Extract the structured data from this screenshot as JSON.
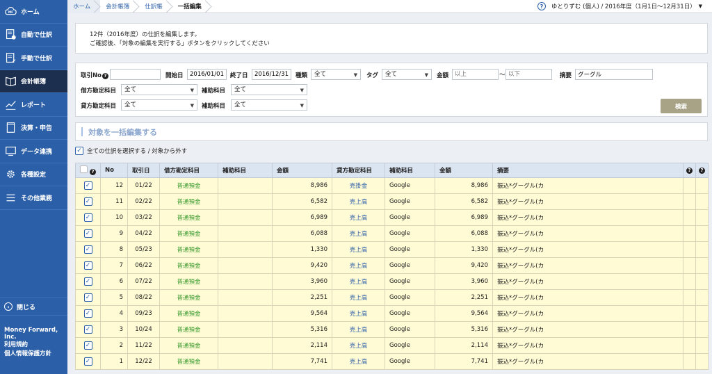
{
  "sidebar": {
    "items": [
      {
        "label": "ホーム",
        "icon": "cloud-mf-icon"
      },
      {
        "label": "自動で仕訳",
        "icon": "auto-journal-icon"
      },
      {
        "label": "手動で仕訳",
        "icon": "manual-journal-icon"
      },
      {
        "label": "会計帳簿",
        "icon": "ledger-book-icon"
      },
      {
        "label": "レポート",
        "icon": "report-chart-icon"
      },
      {
        "label": "決算・申告",
        "icon": "settlement-icon"
      },
      {
        "label": "データ連携",
        "icon": "data-link-icon"
      },
      {
        "label": "各種設定",
        "icon": "gear-icon"
      },
      {
        "label": "その他業務",
        "icon": "list-icon"
      }
    ],
    "close_label": "閉じる",
    "company": "Money Forward, Inc.",
    "terms": "利用規約",
    "privacy": "個人情報保護方針"
  },
  "breadcrumb": {
    "home": "ホーム",
    "ledger": "会計帳簿",
    "journal": "仕訳帳",
    "current": "一括編集"
  },
  "header": {
    "help": "?",
    "user_info": "ゆとりずむ (個人) / 2016年度（1月1日〜12月31日）"
  },
  "notice": {
    "line1": "12件（2016年度）の仕訳を編集します。",
    "line2": "ご確認後、「対象の編集を実行する」ボタンをクリックしてください"
  },
  "filter": {
    "trade_no_label": "取引No",
    "trade_no_value": "",
    "start_label": "開始日",
    "start_value": "2016/01/01",
    "end_label": "終了日",
    "end_value": "2016/12/31",
    "type_label": "種類",
    "type_value": "全て",
    "tag_label": "タグ",
    "tag_value": "全て",
    "amount_label": "金額",
    "amount_min_placeholder": "以上",
    "amount_sep": "〜",
    "amount_max_placeholder": "以下",
    "memo_label": "摘要",
    "memo_value": "グーグル",
    "debit_label": "借方勘定科目",
    "debit_value": "全て",
    "debit_sub_label": "補助科目",
    "debit_sub_value": "全て",
    "credit_label": "貸方勘定科目",
    "credit_value": "全て",
    "credit_sub_label": "補助科目",
    "credit_sub_value": "全て",
    "search_button": "検索"
  },
  "bulk": {
    "title": "対象を一括編集する",
    "select_all": "全ての仕訳を選択する / 対象から外す"
  },
  "table": {
    "headers": {
      "no": "No",
      "date": "取引日",
      "debit": "借方勘定科目",
      "debit_sub": "補助科目",
      "debit_amount": "金額",
      "credit": "貸方勘定科目",
      "credit_sub": "補助科目",
      "credit_amount": "金額",
      "memo": "摘要"
    },
    "rows": [
      {
        "no": "12",
        "date": "01/22",
        "debit": "普通預金",
        "debit_sub": "",
        "debit_amount": "8,986",
        "credit": "売掛金",
        "credit_sub": "Google",
        "credit_amount": "8,986",
        "memo": "振込*グーグル(カ"
      },
      {
        "no": "11",
        "date": "02/22",
        "debit": "普通預金",
        "debit_sub": "",
        "debit_amount": "6,582",
        "credit": "売上高",
        "credit_sub": "Google",
        "credit_amount": "6,582",
        "memo": "振込*グーグル(カ"
      },
      {
        "no": "10",
        "date": "03/22",
        "debit": "普通預金",
        "debit_sub": "",
        "debit_amount": "6,989",
        "credit": "売上高",
        "credit_sub": "Google",
        "credit_amount": "6,989",
        "memo": "振込*グーグル(カ"
      },
      {
        "no": "9",
        "date": "04/22",
        "debit": "普通預金",
        "debit_sub": "",
        "debit_amount": "6,088",
        "credit": "売上高",
        "credit_sub": "Google",
        "credit_amount": "6,088",
        "memo": "振込*グーグル(カ"
      },
      {
        "no": "8",
        "date": "05/23",
        "debit": "普通預金",
        "debit_sub": "",
        "debit_amount": "1,330",
        "credit": "売上高",
        "credit_sub": "Google",
        "credit_amount": "1,330",
        "memo": "振込*グーグル(カ"
      },
      {
        "no": "7",
        "date": "06/22",
        "debit": "普通預金",
        "debit_sub": "",
        "debit_amount": "9,420",
        "credit": "売上高",
        "credit_sub": "Google",
        "credit_amount": "9,420",
        "memo": "振込*グーグル(カ"
      },
      {
        "no": "6",
        "date": "07/22",
        "debit": "普通預金",
        "debit_sub": "",
        "debit_amount": "3,960",
        "credit": "売上高",
        "credit_sub": "Google",
        "credit_amount": "3,960",
        "memo": "振込*グーグル(カ"
      },
      {
        "no": "5",
        "date": "08/22",
        "debit": "普通預金",
        "debit_sub": "",
        "debit_amount": "2,251",
        "credit": "売上高",
        "credit_sub": "Google",
        "credit_amount": "2,251",
        "memo": "振込*グーグル(カ"
      },
      {
        "no": "4",
        "date": "09/23",
        "debit": "普通預金",
        "debit_sub": "",
        "debit_amount": "9,564",
        "credit": "売上高",
        "credit_sub": "Google",
        "credit_amount": "9,564",
        "memo": "振込*グーグル(カ"
      },
      {
        "no": "3",
        "date": "10/24",
        "debit": "普通預金",
        "debit_sub": "",
        "debit_amount": "5,316",
        "credit": "売上高",
        "credit_sub": "Google",
        "credit_amount": "5,316",
        "memo": "振込*グーグル(カ"
      },
      {
        "no": "2",
        "date": "11/22",
        "debit": "普通預金",
        "debit_sub": "",
        "debit_amount": "2,114",
        "credit": "売上高",
        "credit_sub": "Google",
        "credit_amount": "2,114",
        "memo": "振込*グーグル(カ"
      },
      {
        "no": "1",
        "date": "12/22",
        "debit": "普通預金",
        "debit_sub": "",
        "debit_amount": "7,741",
        "credit": "売上高",
        "credit_sub": "Google",
        "credit_amount": "7,741",
        "memo": "振込*グーグル(カ"
      }
    ]
  },
  "colors": {
    "sidebar": "#2b5fa8",
    "sidebar_active": "#1c2f4f",
    "row_bg": "#fffbd5",
    "header_bg": "#dbe4f1",
    "account_green": "#3a9a2e",
    "account_blue": "#2b5fa8",
    "search_button": "#a8a386"
  }
}
